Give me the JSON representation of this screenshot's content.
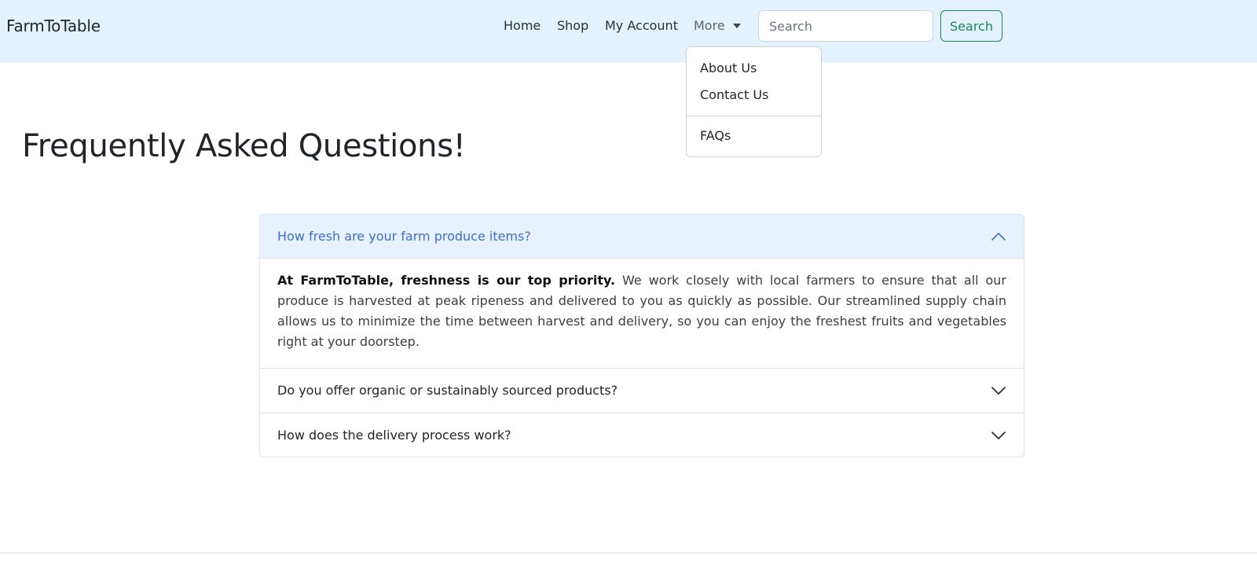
{
  "navbar": {
    "brand": "FarmToTable",
    "links": {
      "home": "Home",
      "shop": "Shop",
      "account": "My Account",
      "more": "More"
    },
    "search": {
      "placeholder": "Search",
      "value": "",
      "button_label": "Search"
    }
  },
  "dropdown": {
    "items": [
      "About Us",
      "Contact Us",
      "FAQs"
    ]
  },
  "page": {
    "title": "Frequently Asked Questions!"
  },
  "faq": [
    {
      "question": "How fresh are your farm produce items?",
      "expanded": true,
      "answer_lead": "At FarmToTable, freshness is our top priority.",
      "answer_rest": " We work closely with local farmers to ensure that all our produce is harvested at peak ripeness and delivered to you as quickly as possible. Our streamlined supply chain allows us to minimize the time between harvest and delivery, so you can enjoy the freshest fruits and vegetables right at your doorstep."
    },
    {
      "question": "Do you offer organic or sustainably sourced products?",
      "expanded": false
    },
    {
      "question": "How does the delivery process work?",
      "expanded": false
    }
  ],
  "colors": {
    "navbar_bg": "#e3f2fd",
    "accent_green": "#198754",
    "active_header_bg": "#e7f1ff",
    "active_header_text": "#3d6fcb"
  },
  "icons": {
    "more_caret": "caret-down-icon",
    "expanded_chevron": "chevron-up-icon",
    "collapsed_chevron": "chevron-down-icon"
  }
}
